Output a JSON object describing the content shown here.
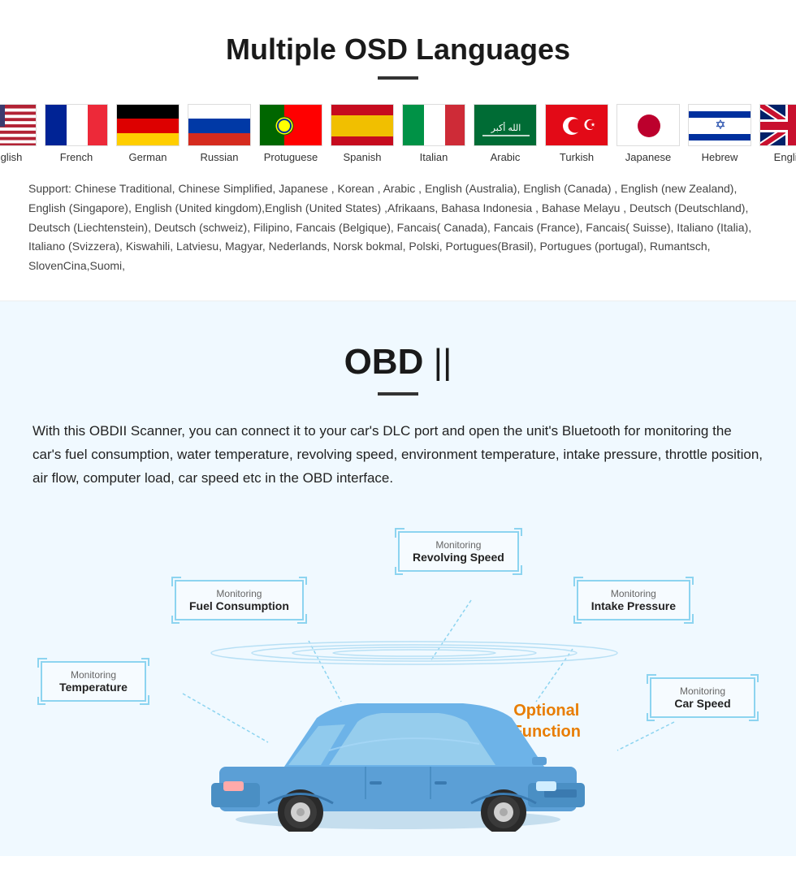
{
  "osd": {
    "title": "Multiple OSD Languages",
    "flags": [
      {
        "label": "English",
        "type": "us"
      },
      {
        "label": "French",
        "type": "fr"
      },
      {
        "label": "German",
        "type": "de"
      },
      {
        "label": "Russian",
        "type": "ru"
      },
      {
        "label": "Protuguese",
        "type": "pt"
      },
      {
        "label": "Spanish",
        "type": "es"
      },
      {
        "label": "Italian",
        "type": "it"
      },
      {
        "label": "Arabic",
        "type": "ar"
      },
      {
        "label": "Turkish",
        "type": "tr"
      },
      {
        "label": "Japanese",
        "type": "jp"
      },
      {
        "label": "Hebrew",
        "type": "il"
      },
      {
        "label": "English",
        "type": "gb"
      }
    ],
    "support_text": "Support: Chinese Traditional, Chinese Simplified, Japanese , Korean , Arabic , English (Australia), English (Canada) , English (new Zealand), English (Singapore), English (United kingdom),English (United States) ,Afrikaans, Bahasa Indonesia , Bahase Melayu , Deutsch (Deutschland), Deutsch (Liechtenstein), Deutsch (schweiz), Filipino, Fancais (Belgique), Fancais( Canada), Fancais (France), Fancais( Suisse), Italiano (Italia), Italiano (Svizzera), Kiswahili, Latviesu, Magyar, Nederlands, Norsk bokmal, Polski, Portugues(Brasil), Portugues (portugal), Rumantsch, SlovenCina,Suomi,"
  },
  "obd": {
    "title_prefix": "OBD ",
    "title_suffix": "||",
    "description": "With this OBDII Scanner, you can connect it to your car's DLC port and open the unit's Bluetooth for monitoring the car's fuel consumption, water temperature, revolving speed, environment temperature, intake pressure, throttle position, air flow, computer load, car speed etc in the OBD interface.",
    "monitors": {
      "revolving": {
        "label": "Monitoring",
        "name": "Revolving Speed"
      },
      "fuel": {
        "label": "Monitoring",
        "name": "Fuel Consumption"
      },
      "intake": {
        "label": "Monitoring",
        "name": "Intake Pressure"
      },
      "temperature": {
        "label": "Monitoring",
        "name": "Temperature"
      },
      "carspeed": {
        "label": "Monitoring",
        "name": "Car Speed"
      }
    },
    "optional": {
      "line1": "Optional",
      "line2": "Function"
    }
  }
}
